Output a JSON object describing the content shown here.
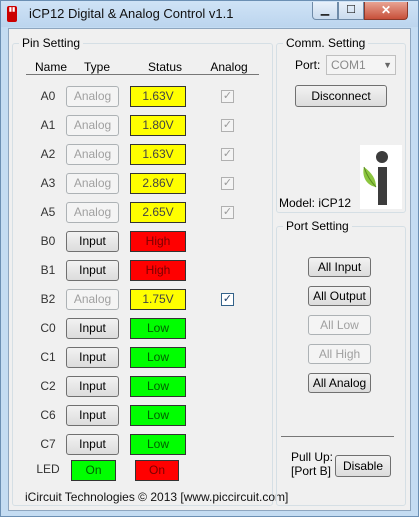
{
  "window": {
    "title": "iCP12 Digital & Analog Control v1.1",
    "minimize_glyph": "▁",
    "maximize_glyph": "☐",
    "close_glyph": "✕"
  },
  "pin_setting": {
    "title": "Pin Setting",
    "headers": {
      "name": "Name",
      "type": "Type",
      "status": "Status",
      "analog": "Analog"
    },
    "rows": [
      {
        "name": "A0",
        "type": "Analog",
        "type_enabled": false,
        "status": "1.63V",
        "status_color": "#ffff00",
        "status_text_color": "#444",
        "analog_checked": true,
        "analog_enabled": false
      },
      {
        "name": "A1",
        "type": "Analog",
        "type_enabled": false,
        "status": "1.80V",
        "status_color": "#ffff00",
        "status_text_color": "#444",
        "analog_checked": true,
        "analog_enabled": false
      },
      {
        "name": "A2",
        "type": "Analog",
        "type_enabled": false,
        "status": "1.63V",
        "status_color": "#ffff00",
        "status_text_color": "#444",
        "analog_checked": true,
        "analog_enabled": false
      },
      {
        "name": "A3",
        "type": "Analog",
        "type_enabled": false,
        "status": "2.86V",
        "status_color": "#ffff00",
        "status_text_color": "#444",
        "analog_checked": true,
        "analog_enabled": false
      },
      {
        "name": "A5",
        "type": "Analog",
        "type_enabled": false,
        "status": "2.65V",
        "status_color": "#ffff00",
        "status_text_color": "#444",
        "analog_checked": true,
        "analog_enabled": false
      },
      {
        "name": "B0",
        "type": "Input",
        "type_enabled": true,
        "status": "High",
        "status_color": "#ff0000",
        "status_text_color": "#7a0000",
        "analog_checked": null,
        "analog_enabled": false
      },
      {
        "name": "B1",
        "type": "Input",
        "type_enabled": true,
        "status": "High",
        "status_color": "#ff0000",
        "status_text_color": "#7a0000",
        "analog_checked": null,
        "analog_enabled": false
      },
      {
        "name": "B2",
        "type": "Analog",
        "type_enabled": false,
        "status": "1.75V",
        "status_color": "#ffff00",
        "status_text_color": "#444",
        "analog_checked": true,
        "analog_enabled": true
      },
      {
        "name": "C0",
        "type": "Input",
        "type_enabled": true,
        "status": "Low",
        "status_color": "#00ff00",
        "status_text_color": "#006000",
        "analog_checked": null,
        "analog_enabled": false
      },
      {
        "name": "C1",
        "type": "Input",
        "type_enabled": true,
        "status": "Low",
        "status_color": "#00ff00",
        "status_text_color": "#006000",
        "analog_checked": null,
        "analog_enabled": false
      },
      {
        "name": "C2",
        "type": "Input",
        "type_enabled": true,
        "status": "Low",
        "status_color": "#00ff00",
        "status_text_color": "#006000",
        "analog_checked": null,
        "analog_enabled": false
      },
      {
        "name": "C6",
        "type": "Input",
        "type_enabled": true,
        "status": "Low",
        "status_color": "#00ff00",
        "status_text_color": "#006000",
        "analog_checked": null,
        "analog_enabled": false
      },
      {
        "name": "C7",
        "type": "Input",
        "type_enabled": true,
        "status": "Low",
        "status_color": "#00ff00",
        "status_text_color": "#006000",
        "analog_checked": null,
        "analog_enabled": false
      }
    ],
    "led": {
      "label": "LED",
      "on_label": "On",
      "on_color": "#00ff00",
      "on_text_color": "#006000",
      "off_label": "On",
      "off_color": "#ff0000",
      "off_text_color": "#7a0000"
    },
    "footer": "iCircuit Technologies © 2013 [www.piccircuit.com]"
  },
  "comm_setting": {
    "title": "Comm. Setting",
    "port_label": "Port:",
    "port_value": "COM1",
    "disconnect_label": "Disconnect",
    "model_label": "Model: iCP12",
    "logo_icon": "icircuit-logo-icon"
  },
  "port_setting": {
    "title": "Port Setting",
    "buttons": [
      {
        "label": "All Input",
        "enabled": true
      },
      {
        "label": "All Output",
        "enabled": true
      },
      {
        "label": "All Low",
        "enabled": false
      },
      {
        "label": "All High",
        "enabled": false
      },
      {
        "label": "All Analog",
        "enabled": true
      }
    ],
    "pullup_label_1": "Pull Up:",
    "pullup_label_2": "[Port B]",
    "disable_label": "Disable"
  }
}
